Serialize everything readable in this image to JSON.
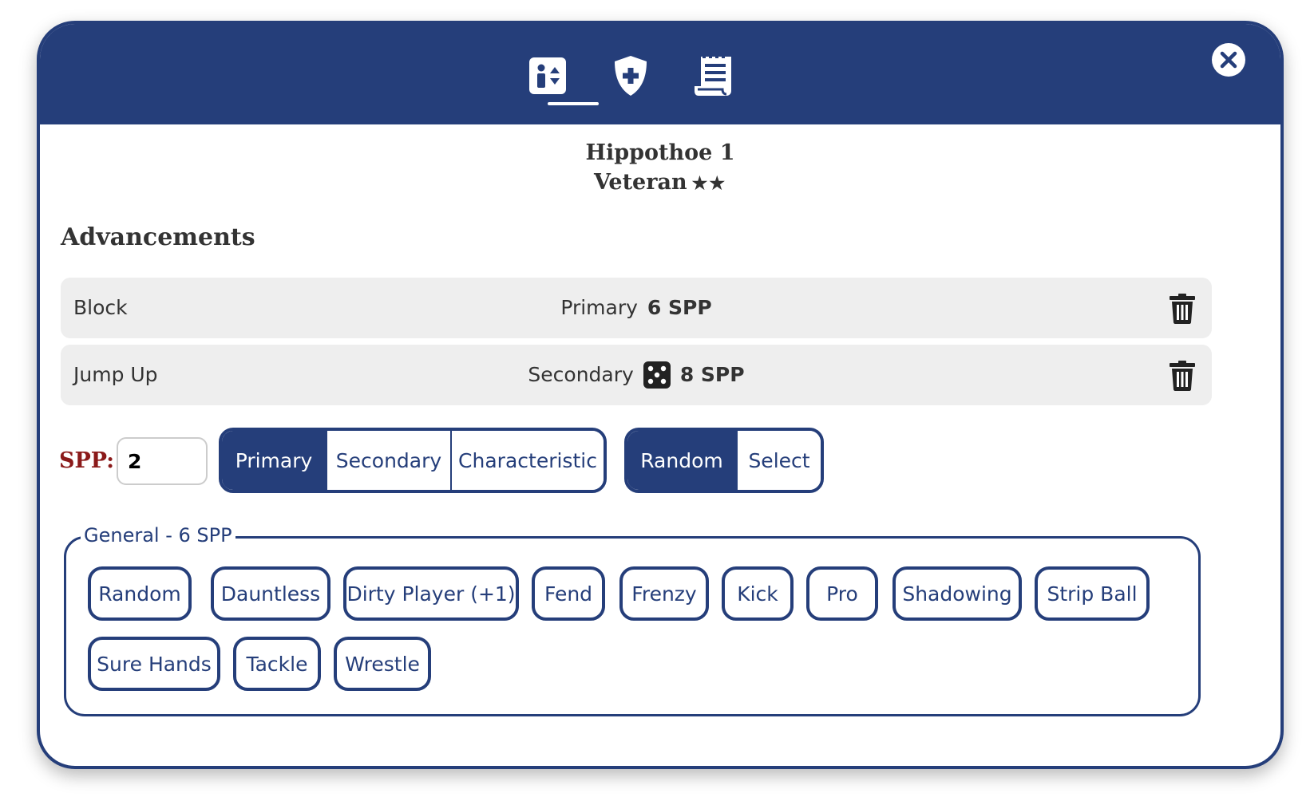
{
  "header": {
    "tabs": [
      {
        "icon": "player-profile-icon"
      },
      {
        "icon": "shield-plus-icon"
      },
      {
        "icon": "scroll-notes-icon"
      }
    ],
    "active_tab": 0,
    "close_icon": "close-icon"
  },
  "player": {
    "name": "Hippothoe 1",
    "rank": "Veteran",
    "stars": "★★"
  },
  "advancements": {
    "title": "Advancements",
    "rows": [
      {
        "skill": "Block",
        "category": "Primary",
        "random": false,
        "spp": "6 SPP"
      },
      {
        "skill": "Jump Up",
        "category": "Secondary",
        "random": true,
        "spp": "8 SPP"
      }
    ]
  },
  "controls": {
    "spp_label": "SPP:",
    "spp_value": "2",
    "category_options": [
      "Primary",
      "Secondary",
      "Characteristic"
    ],
    "category_selected": "Primary",
    "method_options": [
      "Random",
      "Select"
    ],
    "method_selected": "Random"
  },
  "skills": {
    "legend": "General - 6 SPP",
    "items": [
      "Random",
      "Dauntless",
      "Dirty Player (+1)",
      "Fend",
      "Frenzy",
      "Kick",
      "Pro",
      "Shadowing",
      "Strip Ball",
      "Sure Hands",
      "Tackle",
      "Wrestle"
    ]
  },
  "colors": {
    "primary": "#253e7a",
    "spp_label": "#8b1a1a",
    "row_bg": "#eeeeee"
  }
}
